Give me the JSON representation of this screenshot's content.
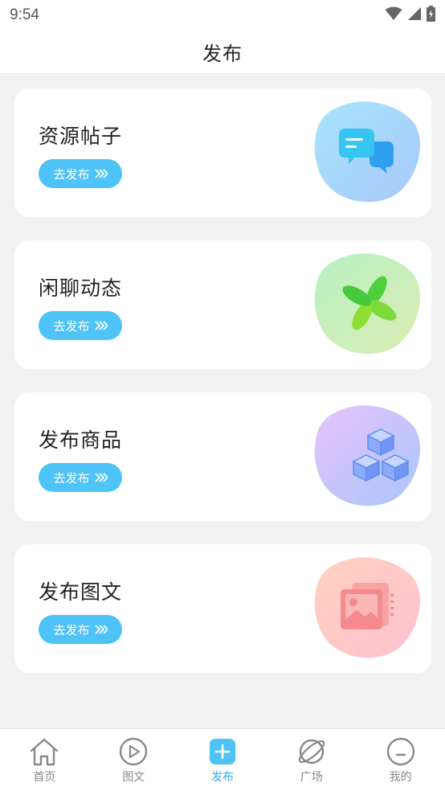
{
  "status_bar": {
    "time": "9:54"
  },
  "header": {
    "title": "发布"
  },
  "cards": [
    {
      "title": "资源帖子",
      "button_label": "去发布",
      "icon": "chat-bubbles-icon"
    },
    {
      "title": "闲聊动态",
      "button_label": "去发布",
      "icon": "pinwheel-icon"
    },
    {
      "title": "发布商品",
      "button_label": "去发布",
      "icon": "cubes-icon"
    },
    {
      "title": "发布图文",
      "button_label": "去发布",
      "icon": "image-stack-icon"
    }
  ],
  "tabbar": {
    "items": [
      {
        "label": "首页",
        "icon": "home-icon"
      },
      {
        "label": "图文",
        "icon": "play-circle-icon"
      },
      {
        "label": "发布",
        "icon": "plus-square-icon",
        "active": true
      },
      {
        "label": "广场",
        "icon": "planet-icon"
      },
      {
        "label": "我的",
        "icon": "smile-icon"
      }
    ]
  },
  "colors": {
    "accent": "#4ec3f7",
    "active_tab": "#3aa6f0",
    "background": "#f2f2f2"
  }
}
